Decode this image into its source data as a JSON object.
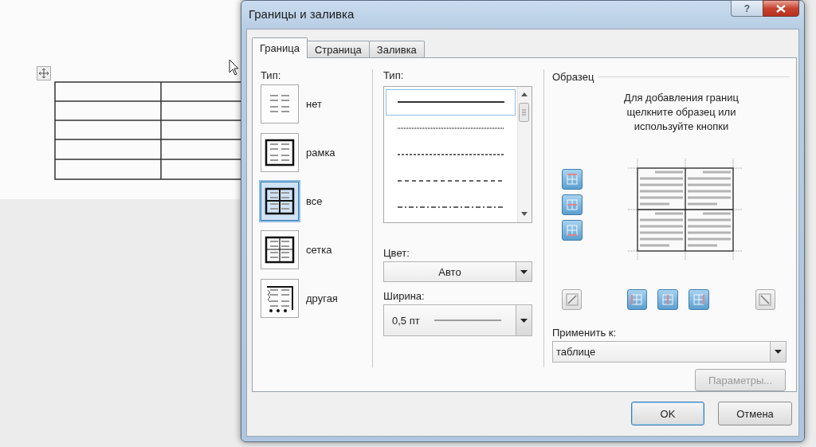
{
  "window": {
    "title": "Границы и заливка",
    "help_label": "?"
  },
  "tabs": [
    {
      "label": "Граница",
      "selected": true
    },
    {
      "label": "Страница",
      "selected": false
    },
    {
      "label": "Заливка",
      "selected": false
    }
  ],
  "setting": {
    "label": "Тип:",
    "presets": [
      {
        "kind": "none",
        "label": "нет",
        "selected": false
      },
      {
        "kind": "box",
        "label": "рамка",
        "selected": false
      },
      {
        "kind": "all",
        "label": "все",
        "selected": true
      },
      {
        "kind": "grid",
        "label": "сетка",
        "selected": false
      },
      {
        "kind": "custom",
        "label": "другая",
        "selected": false
      }
    ]
  },
  "style": {
    "label": "Тип:",
    "lines": [
      {
        "kind": "solid",
        "selected": true
      },
      {
        "kind": "dotted",
        "selected": false
      },
      {
        "kind": "fine-dash",
        "selected": false
      },
      {
        "kind": "dash",
        "selected": false
      },
      {
        "kind": "dash-dot",
        "selected": false
      }
    ]
  },
  "color": {
    "label": "Цвет:",
    "value": "Авто"
  },
  "width": {
    "label": "Ширина:",
    "value": "0,5 пт"
  },
  "preview": {
    "title": "Образец",
    "hint": "Для добавления границ щелкните образец или используйте кнопки",
    "side_buttons": [
      {
        "kind": "top",
        "pressed": true
      },
      {
        "kind": "inside-horizontal",
        "pressed": true
      },
      {
        "kind": "bottom",
        "pressed": true
      }
    ],
    "bottom_buttons": [
      {
        "kind": "diagonal-up",
        "pressed": false
      },
      {
        "kind": "left",
        "pressed": true
      },
      {
        "kind": "inside-vertical",
        "pressed": true
      },
      {
        "kind": "right",
        "pressed": true
      },
      {
        "kind": "diagonal-down",
        "pressed": false
      }
    ]
  },
  "apply_to": {
    "label": "Применить к:",
    "value": "таблице"
  },
  "options_button": {
    "label": "Параметры...",
    "disabled": true
  },
  "buttons": [
    {
      "label": "OK",
      "kind": "default"
    },
    {
      "label": "Отмена",
      "kind": "normal"
    }
  ]
}
